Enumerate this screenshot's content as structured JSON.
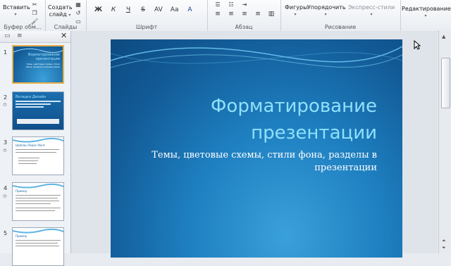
{
  "ribbon": {
    "clipboard": {
      "paste_label": "Вставить",
      "group_label": "Буфер обм..."
    },
    "slides": {
      "create_label_1": "Создать",
      "create_label_2": "слайд",
      "group_label": "Слайды"
    },
    "font": {
      "group_label": "Шрифт",
      "bold": "Ж",
      "italic": "К",
      "underline": "Ч",
      "strike": "S",
      "spacing": "AV",
      "case": "Aa"
    },
    "paragraph": {
      "group_label": "Абзац"
    },
    "drawing": {
      "shapes_label": "Фигуры",
      "arrange_label": "Упорядочить",
      "quick_styles_label": "Экспресс-стили",
      "group_label": "Рисование"
    },
    "editing": {
      "label": "Редактирование"
    }
  },
  "thumbnails": [
    {
      "num": "1",
      "title": "Форматирование презентации",
      "subtitle": "Темы, цветовые схемы, стили фона, разделы в презентации"
    },
    {
      "num": "2",
      "title": "Вкладка Дизайн"
    },
    {
      "num": "3",
      "title": "Шаблон Power Point"
    },
    {
      "num": "4",
      "title": "Пример"
    },
    {
      "num": "5",
      "title": "Пример"
    }
  ],
  "slide": {
    "title_line1": "Форматирование",
    "title_line2": "презентации",
    "subtitle": "Темы, цветовые схемы, стили фона, разделы в презентации"
  }
}
